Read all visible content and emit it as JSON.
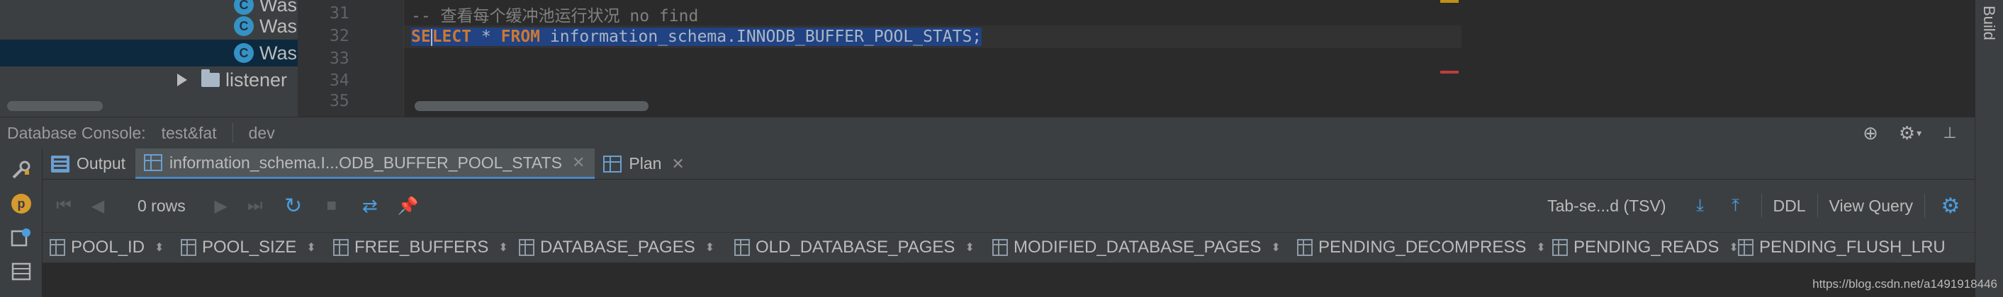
{
  "project_tree": {
    "items": [
      {
        "icon": "class-icon",
        "label": "Was",
        "selected": false
      },
      {
        "icon": "class-icon",
        "label": "Was",
        "selected": false
      },
      {
        "icon": "class-icon",
        "label": "Was",
        "selected": true
      },
      {
        "icon": "folder-icon",
        "label": "listener",
        "selected": false
      }
    ],
    "class_letter": "C"
  },
  "editor": {
    "lines": [
      {
        "no": "31",
        "comment": "-- 查看每个缓冲池运行状况 no find"
      },
      {
        "no": "32",
        "kw1_a": "SE",
        "kw1_b": "LECT",
        "star": " * ",
        "kw2": "FROM",
        "rest": " information_schema.INNODB_BUFFER_POOL_STATS;"
      },
      {
        "no": "33"
      },
      {
        "no": "34"
      },
      {
        "no": "35"
      }
    ]
  },
  "right_sidebar": {
    "label": "Build"
  },
  "console_header": {
    "title": "Database Console:",
    "crumb1": "test&fat",
    "crumb2": "dev",
    "icons": [
      "target-icon",
      "gear-icon",
      "pin-icon"
    ]
  },
  "tabs": [
    {
      "label": "Output",
      "icon": "output-icon",
      "active": false,
      "closable": false
    },
    {
      "label": "information_schema.I...ODB_BUFFER_POOL_STATS",
      "icon": "table-icon",
      "active": true,
      "closable": true
    },
    {
      "label": "Plan",
      "icon": "table-icon",
      "active": false,
      "closable": true
    }
  ],
  "toolbar": {
    "rows": "0 rows",
    "format": "Tab-se...d (TSV)",
    "ddl": "DDL",
    "view_query": "View Query"
  },
  "columns": [
    {
      "name": "POOL_ID"
    },
    {
      "name": "POOL_SIZE"
    },
    {
      "name": "FREE_BUFFERS"
    },
    {
      "name": "DATABASE_PAGES"
    },
    {
      "name": "OLD_DATABASE_PAGES"
    },
    {
      "name": "MODIFIED_DATABASE_PAGES"
    },
    {
      "name": "PENDING_DECOMPRESS"
    },
    {
      "name": "PENDING_READS"
    },
    {
      "name": "PENDING_FLUSH_LRU"
    }
  ],
  "watermark": "https://blog.csdn.net/a1491918446",
  "colors": {
    "bg_dark": "#2b2b2b",
    "panel": "#3c3f41",
    "keyword": "#cc7832",
    "selection": "#214283",
    "accent_blue": "#4a88c7"
  }
}
